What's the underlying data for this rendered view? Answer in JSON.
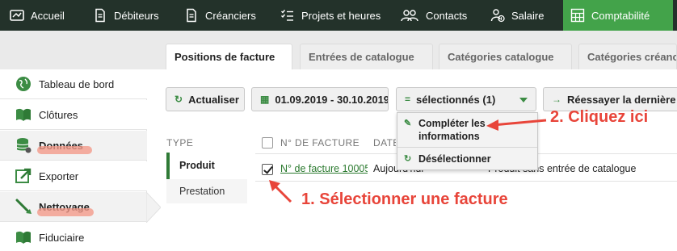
{
  "nav": {
    "items": [
      {
        "label": "Accueil",
        "icon": "home-icon"
      },
      {
        "label": "Débiteurs",
        "icon": "document-icon"
      },
      {
        "label": "Créanciers",
        "icon": "document-icon"
      },
      {
        "label": "Projets et heures",
        "icon": "checklist-icon"
      },
      {
        "label": "Contacts",
        "icon": "people-icon"
      },
      {
        "label": "Salaire",
        "icon": "salary-icon"
      },
      {
        "label": "Comptabilité",
        "icon": "calculator-icon"
      }
    ],
    "active": "Comptabilité"
  },
  "tabs": [
    {
      "label": "Positions de facture",
      "active": true
    },
    {
      "label": "Entrées de catalogue"
    },
    {
      "label": "Catégories catalogue"
    },
    {
      "label": "Catégories créanci"
    }
  ],
  "sidebar": {
    "items": [
      {
        "label": "Tableau de bord",
        "icon": "globe-icon"
      },
      {
        "label": "Clôtures",
        "icon": "book-icon"
      },
      {
        "label": "Données",
        "icon": "database-icon",
        "highlighted": true
      },
      {
        "label": "Exporter",
        "icon": "export-icon"
      },
      {
        "label": "Nettoyage",
        "icon": "broom-icon",
        "highlighted": true
      },
      {
        "label": "Fiduciaire",
        "icon": "book-icon"
      }
    ]
  },
  "toolbar": {
    "refresh": "Actualiser",
    "date_range": "01.09.2019 - 30.10.2019",
    "selection": "sélectionnés (1)",
    "retry": "Réessayer la dernière e"
  },
  "dropdown": {
    "complete": "Compléter les informations",
    "deselect": "Désélectionner"
  },
  "types": {
    "header": "TYPE",
    "items": [
      "Produit",
      "Prestation"
    ],
    "active": "Produit"
  },
  "table": {
    "headers": [
      "N° DE FACTURE",
      "DATE"
    ],
    "rows": [
      {
        "invoice": "N° de facture 10005",
        "date": "Aujourd'hui",
        "description": "Produit sans entrée de catalogue",
        "checked": true
      }
    ]
  },
  "annotations": {
    "step1": "1. Sélectionner une facture",
    "step2": "2. Cliquez ici"
  },
  "colors": {
    "nav_bg": "#23322a",
    "active_green": "#43a34a",
    "accent_green": "#3c8c44",
    "annotation_red": "#e8453a"
  }
}
